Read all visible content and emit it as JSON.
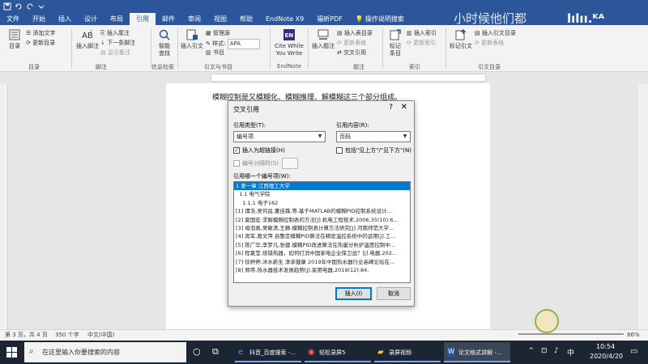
{
  "window": {
    "title_overlay": "小时候他们都",
    "logo_watermark": "lılıı.ᴷᴬ"
  },
  "ribbon_tabs": [
    {
      "label": "文件"
    },
    {
      "label": "开始"
    },
    {
      "label": "插入"
    },
    {
      "label": "设计"
    },
    {
      "label": "布局"
    },
    {
      "label": "引用",
      "active": true
    },
    {
      "label": "邮件"
    },
    {
      "label": "审阅"
    },
    {
      "label": "视图"
    },
    {
      "label": "帮助"
    },
    {
      "label": "EndNote X9"
    },
    {
      "label": "福昕PDF"
    },
    {
      "label": "操作说明搜索",
      "icon": "lightbulb"
    }
  ],
  "ribbon": {
    "toc": "目录",
    "add_text": "添加文字",
    "update_toc": "更新目录",
    "group_toc": "目录",
    "footnote": "插入脚注",
    "insert_endnote": "插入尾注",
    "next_footnote": "下一条脚注",
    "show_notes": "显示备注",
    "group_footnote": "脚注",
    "smart_lookup": "智能\n查找",
    "group_info": "信息检索",
    "insert_citation": "插入引文",
    "manage_sources": "管理源",
    "style_label": "样式:",
    "style_value": "APA",
    "bibliography": "书目",
    "group_citations": "引文与书目",
    "cite_while": "Cite While\nYou Write",
    "group_endnote": "EndNote",
    "insert_caption": "插入题注",
    "insert_table_figures": "插入表目录",
    "update_table": "更新表格",
    "cross_reference": "交叉引用",
    "group_caption": "题注",
    "mark_entry": "标记\n条目",
    "insert_index": "插入索引",
    "update_index": "更新索引",
    "group_index": "索引",
    "mark_citation": "标记引文",
    "insert_toa": "插入引文目录",
    "update_toa": "更新表格",
    "group_toa": "引文目录"
  },
  "document": {
    "text": "模糊控制是又模糊化、模糊推理、解模糊这三个部分组成。"
  },
  "dialog": {
    "title": "交叉引用",
    "help": "?",
    "close": "✕",
    "ref_type_label": "引用类型(T):",
    "ref_type_value": "编号项",
    "ref_content_label": "引用内容(R):",
    "ref_content_value": "页码",
    "insert_hyperlink_label": "插入为超链接(H)",
    "insert_hyperlink_checked": true,
    "include_above_below_label": "包括\"见上方\"/\"见下方\"(N)",
    "include_above_below_checked": false,
    "separate_numbers_label": "编号分隔符(S)",
    "separate_numbers_checked": false,
    "list_label": "引用哪一个编号项(W):",
    "items": [
      "1 第一章  江西理工大学",
      "  1.1 电气学院",
      "    1.1.1 电子162",
      "[1] 谭浩,吴何昌,董佳霖,等.基于MATLAB的模糊PID控制系统设计...",
      "[2] 夏国宏.求解模糊控制表的方法[J].机电工程技术,2006,35(10):6...",
      "[3] 母泡真,吴敏清,王静.模糊控制表计算方法研究[J].河南师范大学...",
      "[4] 闵军,葛文萍.自整定模糊PID算法在精密温控系统中的运用[J].工...",
      "[5] 陈广华,李梦凡,张健.模糊PID改进算法在热量分析炉温度控制中...",
      "[6] 程夏莹.烧错热器，如何打消中国家电企业保卫战？[J].电器,202...",
      "[7] 徐婷婷.沐水新生 净享健康 2019年中国热水器行业高峰论坛在...",
      "[8] 郑伟.热水器技术发展趋势[J].家用电器,2019(12):84."
    ],
    "selected_index": 0,
    "insert_button": "插入(I)",
    "cancel_button": "取消"
  },
  "status_bar": {
    "page": "第 3 页，共 4 页",
    "words": "350 个字",
    "language": "中文(中国)",
    "zoom": "86%"
  },
  "taskbar": {
    "search_placeholder": "在这里输入你要搜索的内容",
    "apps": [
      {
        "label": "抖音_百度搜索 -...",
        "icon": "browser"
      },
      {
        "label": "轻松录屏5",
        "icon": "recorder"
      },
      {
        "label": "录屏视频",
        "icon": "folder"
      },
      {
        "label": "论文格式讲解 -...",
        "icon": "word"
      }
    ],
    "ime": "中",
    "time": "10:54",
    "date": "2020/4/20"
  },
  "colors": {
    "word_blue": "#2b579a",
    "taskbar": "#1c2533",
    "selection": "#0078d7",
    "dialog_bg": "#f0f0f0"
  }
}
